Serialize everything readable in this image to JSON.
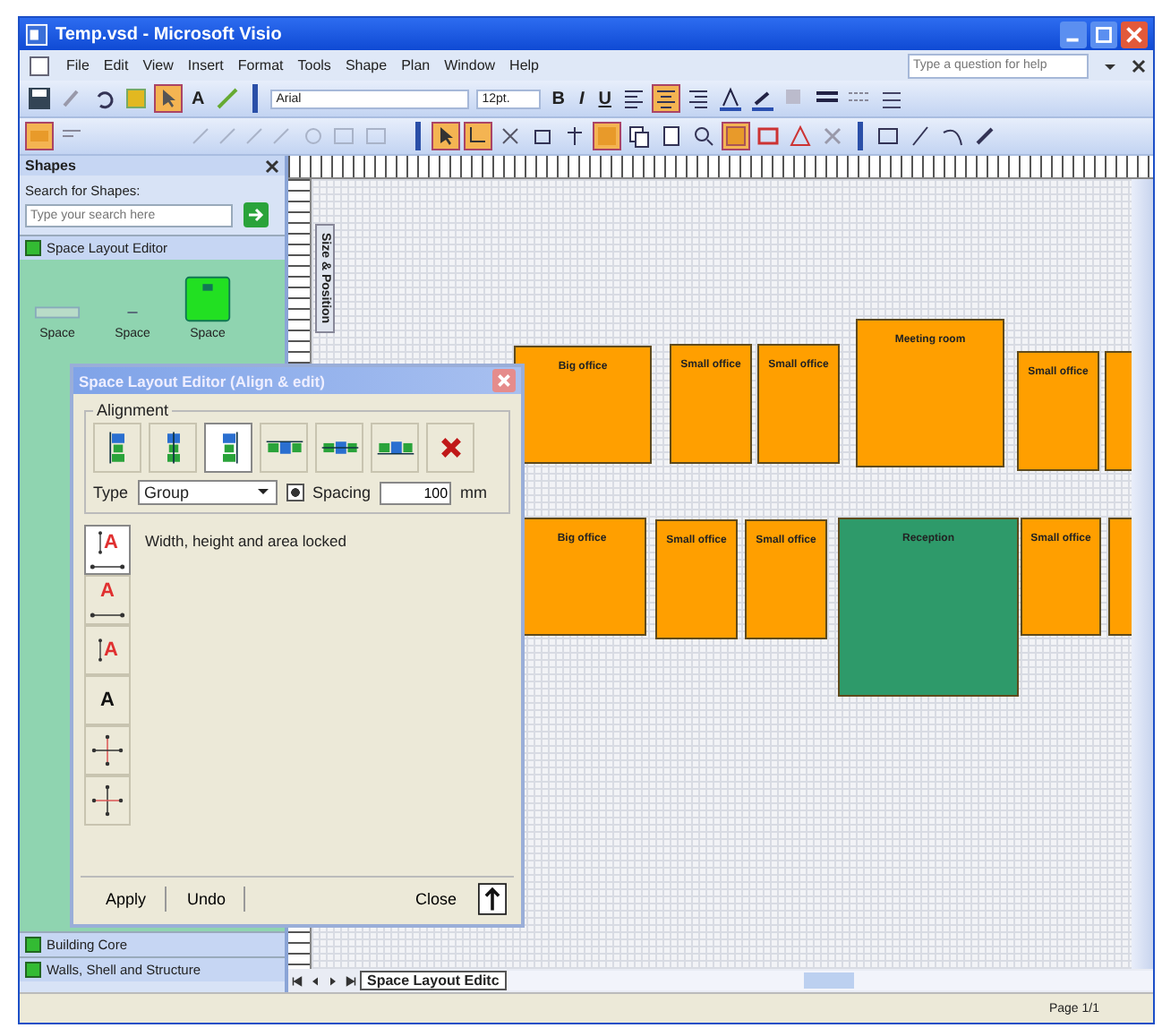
{
  "window": {
    "title": "Temp.vsd - Microsoft Visio"
  },
  "menu": [
    "File",
    "Edit",
    "View",
    "Insert",
    "Format",
    "Tools",
    "Shape",
    "Plan",
    "Window",
    "Help"
  ],
  "help_search": {
    "placeholder": "Type a question for help"
  },
  "format_toolbar": {
    "font": "Arial",
    "size": "12pt.",
    "styles": [
      "B",
      "I",
      "U"
    ],
    "text_tool": "A"
  },
  "shapes_panel": {
    "title": "Shapes",
    "search_label": "Search for Shapes:",
    "search": {
      "placeholder": "Type your search here"
    },
    "open_stencil": "Space Layout Editor",
    "stencil_items": [
      "Space",
      "Space",
      "Space"
    ],
    "stencils": [
      "Building Core",
      "Walls, Shell and Structure"
    ]
  },
  "docked_window": {
    "title": "Size & Position"
  },
  "dialog": {
    "title": "Space Layout Editor (Align & edit)",
    "group": "Alignment",
    "align_buttons": [
      {
        "kind": "vertical",
        "selected": false
      },
      {
        "kind": "vertical",
        "selected": false
      },
      {
        "kind": "vertical",
        "selected": true
      },
      {
        "kind": "horizontal",
        "selected": false
      },
      {
        "kind": "horizontal",
        "selected": false
      },
      {
        "kind": "horizontal",
        "selected": false
      },
      {
        "kind": "delete",
        "selected": false
      }
    ],
    "type_label": "Type",
    "type_value": "Group",
    "spacing": {
      "label": "Spacing",
      "checked": true,
      "value": "100",
      "unit": "mm"
    },
    "lock_buttons": [
      {
        "kind": "both",
        "label": "A",
        "selected": true
      },
      {
        "kind": "width",
        "label": "A",
        "selected": false
      },
      {
        "kind": "height",
        "label": "A",
        "selected": false
      },
      {
        "kind": "none",
        "label": "A",
        "selected": false
      },
      {
        "kind": "cross-width",
        "selected": false
      },
      {
        "kind": "cross-height",
        "selected": false
      }
    ],
    "lock_status": "Width, height and area locked",
    "buttons": [
      "Apply",
      "Undo",
      "Close"
    ]
  },
  "canvas": {
    "rooms": [
      {
        "name": "Big office",
        "color": "#ff9f00"
      },
      {
        "name": "Small office",
        "color": "#ff9f00"
      },
      {
        "name": "Small office",
        "color": "#ff9f00"
      },
      {
        "name": "Meeting room",
        "color": "#ff9f00"
      },
      {
        "name": "Small office",
        "color": "#ff9f00"
      },
      {
        "color": "#ff9f00"
      },
      {
        "name": "Big office",
        "color": "#ff9f00"
      },
      {
        "name": "Small office",
        "color": "#ff9f00"
      },
      {
        "name": "Small office",
        "color": "#ff9f00"
      },
      {
        "name": "Reception",
        "color": "#2e9a6a"
      },
      {
        "name": "Small office",
        "color": "#ff9f00"
      },
      {
        "color": "#ff9f00"
      }
    ]
  },
  "sheet_tab": "Space Layout Editc",
  "status_bar": {
    "page": "Page 1/1"
  }
}
